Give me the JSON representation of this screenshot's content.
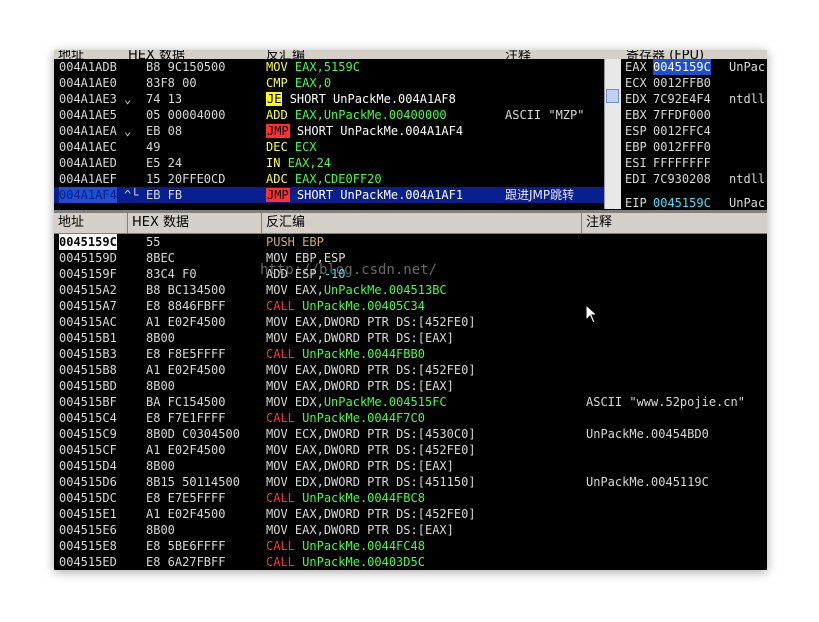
{
  "top_header": {
    "addr": "地址",
    "hex": "HEX 数据",
    "disasm": "反汇编",
    "comment": "注释",
    "regs": "寄存器 (FPU)"
  },
  "cpu_rows": [
    {
      "addr": "004A1ADB",
      "mark": "",
      "hex": "B8 9C150500",
      "op": "MOV",
      "args": "EAX,5159C",
      "comment": ""
    },
    {
      "addr": "004A1AE0",
      "mark": "",
      "hex": "83F8 00",
      "op": "CMP",
      "args": "EAX,0",
      "comment": ""
    },
    {
      "addr": "004A1AE3",
      "mark": "⌄",
      "hex": "74 13",
      "op": "JE",
      "args": "SHORT UnPackMe.004A1AF8",
      "comment": ""
    },
    {
      "addr": "004A1AE5",
      "mark": "",
      "hex": "05 00004000",
      "op": "ADD",
      "args": "EAX,UnPackMe.00400000",
      "comment": "ASCII \"MZP\""
    },
    {
      "addr": "004A1AEA",
      "mark": "⌄",
      "hex": "EB 08",
      "op": "JMP",
      "args": "SHORT UnPackMe.004A1AF4",
      "comment": ""
    },
    {
      "addr": "004A1AEC",
      "mark": "",
      "hex": "49",
      "op": "DEC",
      "args": "ECX",
      "comment": ""
    },
    {
      "addr": "004A1AED",
      "mark": "",
      "hex": "E5 24",
      "op": "IN",
      "args": "EAX,24",
      "comment": ""
    },
    {
      "addr": "004A1AEF",
      "mark": "",
      "hex": "15 20FFE0CD",
      "op": "ADC",
      "args": "EAX,CDE0FF20",
      "comment": ""
    },
    {
      "addr": "004A1AF4",
      "mark": "^└",
      "hex": "EB FB",
      "op": "JMP",
      "args": "SHORT UnPackMe.004A1AF1",
      "comment": "跟进JMP跳转"
    }
  ],
  "registers": [
    {
      "name": "EAX",
      "value": "0045159C",
      "desc": "UnPac"
    },
    {
      "name": "ECX",
      "value": "0012FFB0",
      "desc": ""
    },
    {
      "name": "EDX",
      "value": "7C92E4F4",
      "desc": "ntdll"
    },
    {
      "name": "EBX",
      "value": "7FFDF000",
      "desc": ""
    },
    {
      "name": "ESP",
      "value": "0012FFC4",
      "desc": ""
    },
    {
      "name": "EBP",
      "value": "0012FFF0",
      "desc": ""
    },
    {
      "name": "ESI",
      "value": "FFFFFFFF",
      "desc": ""
    },
    {
      "name": "EDI",
      "value": "7C930208",
      "desc": "ntdll"
    },
    {
      "name": "EIP",
      "value": "0045159C",
      "desc": "UnPac"
    }
  ],
  "bottom_header": {
    "addr": "地址",
    "hex": "HEX 数据",
    "disasm": "反汇编",
    "comment": "注释"
  },
  "dis_rows": [
    {
      "addr": "0045159C",
      "hex": "55",
      "op": "PUSH",
      "args": "EBP",
      "comment": ""
    },
    {
      "addr": "0045159D",
      "hex": "8BEC",
      "op": "MOV",
      "args": "EBP,ESP",
      "comment": ""
    },
    {
      "addr": "0045159F",
      "hex": "83C4 F0",
      "op": "ADD",
      "args": "ESP,-10",
      "comment": ""
    },
    {
      "addr": "004515A2",
      "hex": "B8 BC134500",
      "op": "MOV",
      "args": "EAX,UnPackMe.004513BC",
      "comment": ""
    },
    {
      "addr": "004515A7",
      "hex": "E8 8846FBFF",
      "op": "CALL",
      "args": "UnPackMe.00405C34",
      "comment": ""
    },
    {
      "addr": "004515AC",
      "hex": "A1 E02F4500",
      "op": "MOV",
      "args": "EAX,DWORD PTR DS:[452FE0]",
      "comment": ""
    },
    {
      "addr": "004515B1",
      "hex": "8B00",
      "op": "MOV",
      "args": "EAX,DWORD PTR DS:[EAX]",
      "comment": ""
    },
    {
      "addr": "004515B3",
      "hex": "E8 F8E5FFFF",
      "op": "CALL",
      "args": "UnPackMe.0044FBB0",
      "comment": ""
    },
    {
      "addr": "004515B8",
      "hex": "A1 E02F4500",
      "op": "MOV",
      "args": "EAX,DWORD PTR DS:[452FE0]",
      "comment": ""
    },
    {
      "addr": "004515BD",
      "hex": "8B00",
      "op": "MOV",
      "args": "EAX,DWORD PTR DS:[EAX]",
      "comment": ""
    },
    {
      "addr": "004515BF",
      "hex": "BA FC154500",
      "op": "MOV",
      "args": "EDX,UnPackMe.004515FC",
      "comment": "ASCII \"www.52pojie.cn\""
    },
    {
      "addr": "004515C4",
      "hex": "E8 F7E1FFFF",
      "op": "CALL",
      "args": "UnPackMe.0044F7C0",
      "comment": ""
    },
    {
      "addr": "004515C9",
      "hex": "8B0D C0304500",
      "op": "MOV",
      "args": "ECX,DWORD PTR DS:[4530C0]",
      "comment": "UnPackMe.00454BD0"
    },
    {
      "addr": "004515CF",
      "hex": "A1 E02F4500",
      "op": "MOV",
      "args": "EAX,DWORD PTR DS:[452FE0]",
      "comment": ""
    },
    {
      "addr": "004515D4",
      "hex": "8B00",
      "op": "MOV",
      "args": "EAX,DWORD PTR DS:[EAX]",
      "comment": ""
    },
    {
      "addr": "004515D6",
      "hex": "8B15 50114500",
      "op": "MOV",
      "args": "EDX,DWORD PTR DS:[451150]",
      "comment": "UnPackMe.0045119C"
    },
    {
      "addr": "004515DC",
      "hex": "E8 E7E5FFFF",
      "op": "CALL",
      "args": "UnPackMe.0044FBC8",
      "comment": ""
    },
    {
      "addr": "004515E1",
      "hex": "A1 E02F4500",
      "op": "MOV",
      "args": "EAX,DWORD PTR DS:[452FE0]",
      "comment": ""
    },
    {
      "addr": "004515E6",
      "hex": "8B00",
      "op": "MOV",
      "args": "EAX,DWORD PTR DS:[EAX]",
      "comment": ""
    },
    {
      "addr": "004515E8",
      "hex": "E8 5BE6FFFF",
      "op": "CALL",
      "args": "UnPackMe.0044FC48",
      "comment": ""
    },
    {
      "addr": "004515ED",
      "hex": "E8 6A27FBFF",
      "op": "CALL",
      "args": "UnPackMe.00403D5C",
      "comment": ""
    }
  ],
  "watermark": "http://blog.csdn.net/",
  "colors": {
    "jump": "#ffff00",
    "call": "#ff3030",
    "operand": "#40ff40",
    "selection": "#0a1f8f"
  }
}
